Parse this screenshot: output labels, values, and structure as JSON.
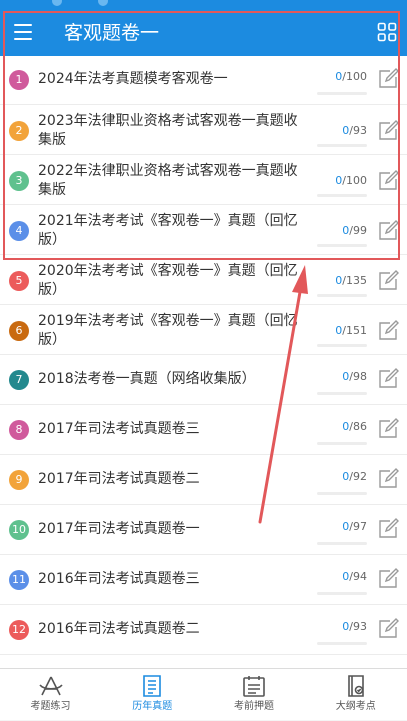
{
  "header": {
    "title": "客观题卷一"
  },
  "icons": {
    "menu": "menu-icon",
    "grid": "grid-view-icon",
    "edit": "edit-icon"
  },
  "colors": {
    "primary": "#1c8be0",
    "annotation": "#e2585a"
  },
  "papers": [
    {
      "num": "1",
      "name": "2024年法考真题模考客观卷一",
      "done": 0,
      "total": 100,
      "total_text": "/100",
      "done_text": "0",
      "color": "#d05a9c"
    },
    {
      "num": "2",
      "name": "2023年法律职业资格考试客观卷一真题收集版",
      "done": 0,
      "total": 93,
      "total_text": "/93",
      "done_text": "0",
      "color": "#f2a33a"
    },
    {
      "num": "3",
      "name": "2022年法律职业资格考试客观卷一真题收集版",
      "done": 0,
      "total": 100,
      "total_text": "/100",
      "done_text": "0",
      "color": "#5fc18e"
    },
    {
      "num": "4",
      "name": "2021年法考考试《客观卷一》真题（回忆版）",
      "done": 0,
      "total": 99,
      "total_text": "/99",
      "done_text": "0",
      "color": "#5b8fe8"
    },
    {
      "num": "5",
      "name": "2020年法考考试《客观卷一》真题（回忆版）",
      "done": 0,
      "total": 135,
      "total_text": "/135",
      "done_text": "0",
      "color": "#ec5b5b"
    },
    {
      "num": "6",
      "name": "2019年法考考试《客观卷一》真题（回忆版）",
      "done": 0,
      "total": 151,
      "total_text": "/151",
      "done_text": "0",
      "color": "#c96a10"
    },
    {
      "num": "7",
      "name": "2018法考卷一真题（网络收集版）",
      "done": 0,
      "total": 98,
      "total_text": "/98",
      "done_text": "0",
      "color": "#23898e"
    },
    {
      "num": "8",
      "name": "2017年司法考试真题卷三",
      "done": 0,
      "total": 86,
      "total_text": "/86",
      "done_text": "0",
      "color": "#d05a9c"
    },
    {
      "num": "9",
      "name": "2017年司法考试真题卷二",
      "done": 0,
      "total": 92,
      "total_text": "/92",
      "done_text": "0",
      "color": "#f2a33a"
    },
    {
      "num": "10",
      "name": "2017年司法考试真题卷一",
      "done": 0,
      "total": 97,
      "total_text": "/97",
      "done_text": "0",
      "color": "#5fc18e"
    },
    {
      "num": "11",
      "name": "2016年司法考试真题卷三",
      "done": 0,
      "total": 94,
      "total_text": "/94",
      "done_text": "0",
      "color": "#5b8fe8"
    },
    {
      "num": "12",
      "name": "2016年司法考试真题卷二",
      "done": 0,
      "total": 93,
      "total_text": "/93",
      "done_text": "0",
      "color": "#ec5b5b"
    }
  ],
  "tabs": [
    {
      "label": "考题练习",
      "icon": "compass-icon",
      "active": false
    },
    {
      "label": "历年真题",
      "icon": "paper-icon",
      "active": true
    },
    {
      "label": "考前押题",
      "icon": "calendar-icon",
      "active": false
    },
    {
      "label": "大纲考点",
      "icon": "outline-book-icon",
      "active": false
    }
  ]
}
